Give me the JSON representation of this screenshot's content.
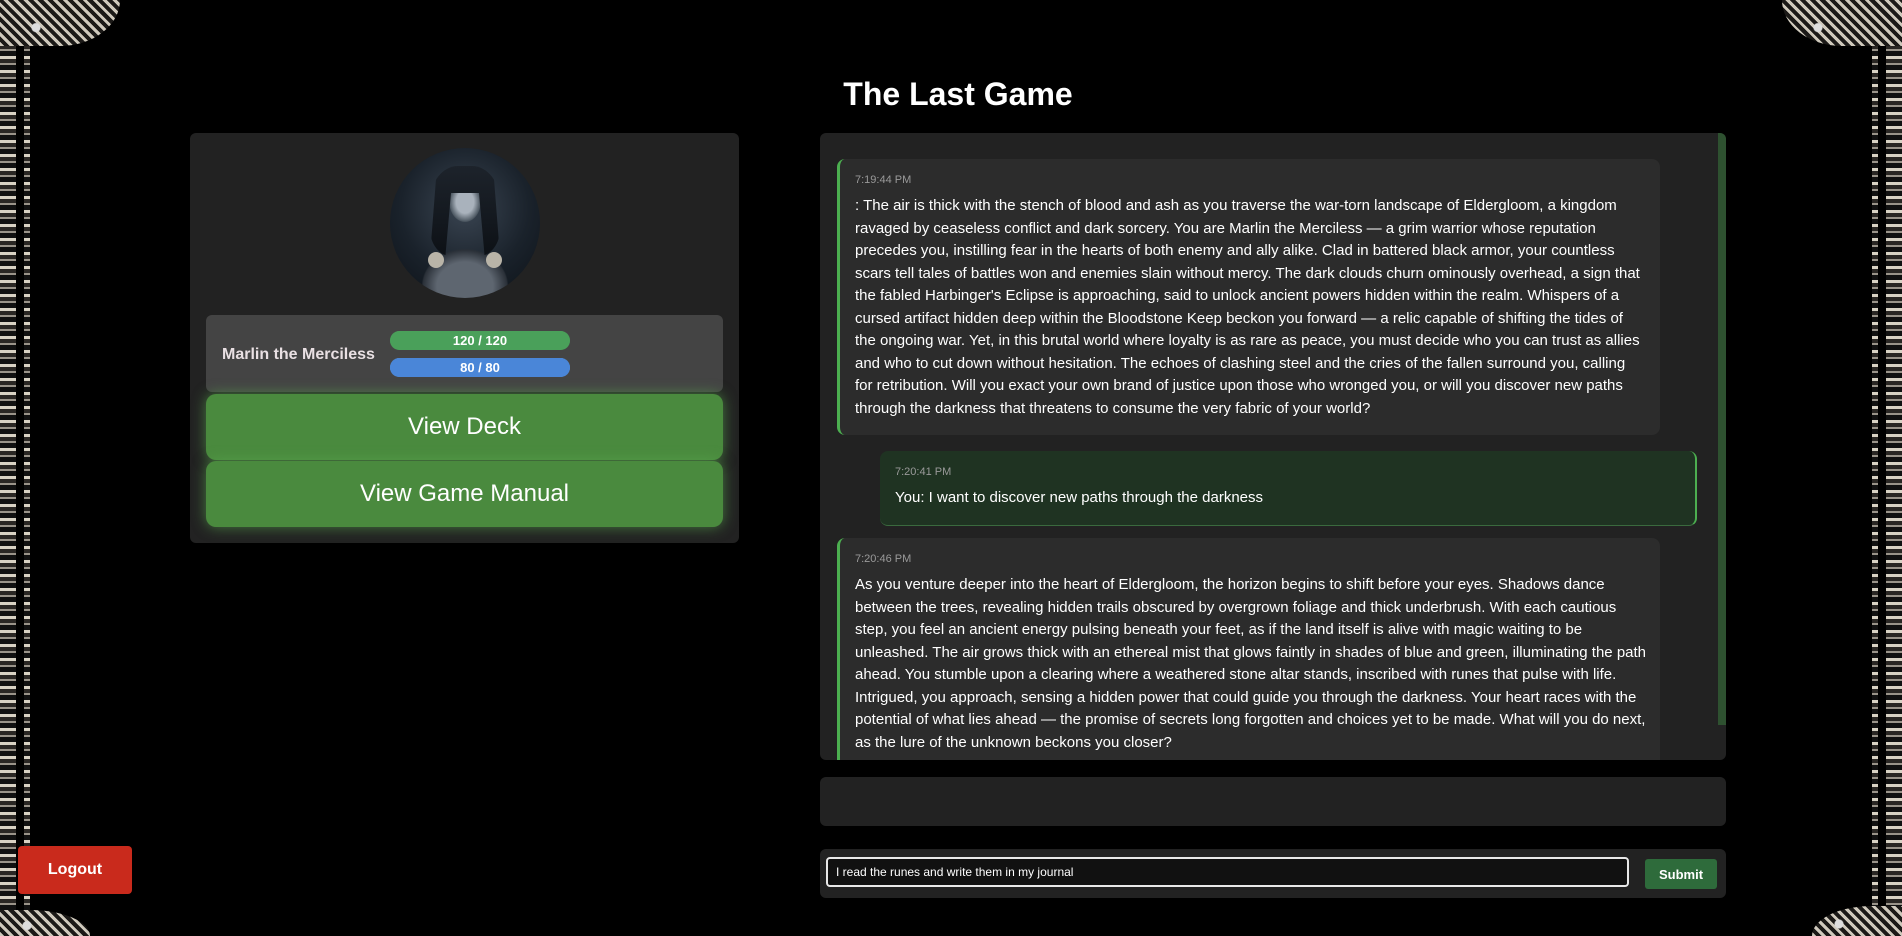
{
  "page": {
    "title": "The Last Game"
  },
  "character": {
    "name": "Marlin the Merciless",
    "hp": {
      "label": "120 / 120",
      "current": 120,
      "max": 120
    },
    "mp": {
      "label": "80 / 80",
      "current": 80,
      "max": 80
    }
  },
  "buttons": {
    "view_deck": "View Deck",
    "view_manual": "View Game Manual",
    "logout": "Logout",
    "submit": "Submit"
  },
  "colors": {
    "accent_green": "#4caf50",
    "logout_red": "#c92a1c",
    "hp": "#4aa05a",
    "mp": "#4a86d8"
  },
  "messages": [
    {
      "role": "narrator",
      "time": "7:19:44 PM",
      "text": ": The air is thick with the stench of blood and ash as you traverse the war-torn landscape of Eldergloom, a kingdom ravaged by ceaseless conflict and dark sorcery. You are Marlin the Merciless — a grim warrior whose reputation precedes you, instilling fear in the hearts of both enemy and ally alike. Clad in battered black armor, your countless scars tell tales of battles won and enemies slain without mercy. The dark clouds churn ominously overhead, a sign that the fabled Harbinger's Eclipse is approaching, said to unlock ancient powers hidden within the realm. Whispers of a cursed artifact hidden deep within the Bloodstone Keep beckon you forward — a relic capable of shifting the tides of the ongoing war. Yet, in this brutal world where loyalty is as rare as peace, you must decide who you can trust as allies and who to cut down without hesitation. The echoes of clashing steel and the cries of the fallen surround you, calling for retribution. Will you exact your own brand of justice upon those who wronged you, or will you discover new paths through the darkness that threatens to consume the very fabric of your world?"
    },
    {
      "role": "user",
      "time": "7:20:41 PM",
      "text": "You: I want to discover new paths through the darkness"
    },
    {
      "role": "narrator",
      "time": "7:20:46 PM",
      "text": "As you venture deeper into the heart of Eldergloom, the horizon begins to shift before your eyes. Shadows dance between the trees, revealing hidden trails obscured by overgrown foliage and thick underbrush. With each cautious step, you feel an ancient energy pulsing beneath your feet, as if the land itself is alive with magic waiting to be unleashed. The air grows thick with an ethereal mist that glows faintly in shades of blue and green, illuminating the path ahead. You stumble upon a clearing where a weathered stone altar stands, inscribed with runes that pulse with life. Intrigued, you approach, sensing a hidden power that could guide you through the darkness. Your heart races with the potential of what lies ahead — the promise of secrets long forgotten and choices yet to be made. What will you do next, as the lure of the unknown beckons you closer?"
    }
  ],
  "input": {
    "value": "I read the runes and write them in my journal"
  }
}
